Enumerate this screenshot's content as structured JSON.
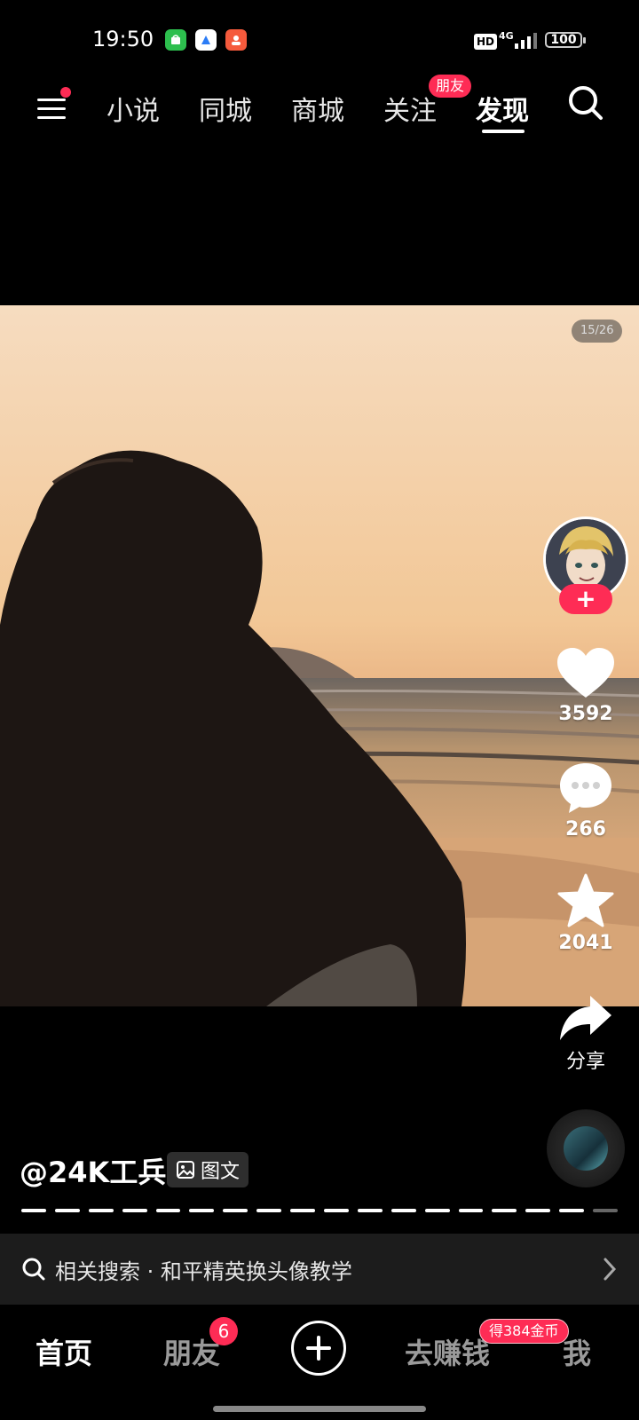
{
  "status_bar": {
    "time": "19:50",
    "hd": "HD",
    "network": "4G",
    "battery": "100",
    "app_icons": [
      "green-shopping-app-icon",
      "blue-app-icon",
      "red-app-icon"
    ]
  },
  "top_nav": {
    "tabs": [
      {
        "label": "小说"
      },
      {
        "label": "同城"
      },
      {
        "label": "商城"
      },
      {
        "label": "关注"
      },
      {
        "label": "发现"
      }
    ],
    "active_tab": "发现",
    "friends_badge": "朋友"
  },
  "post": {
    "page_counter": "15/26",
    "author": "@24K工兵",
    "type_label": "图文",
    "likes": "3592",
    "comments": "266",
    "favorites": "2041",
    "share_label": "分享",
    "total_images": 26,
    "current_image": 15
  },
  "related_search": {
    "text": "相关搜索 · 和平精英换头像教学"
  },
  "bottom_nav": {
    "home": "首页",
    "friends": "朋友",
    "friends_count": "6",
    "earn": "去赚钱",
    "coin_badge": "得384金币",
    "me": "我"
  },
  "colors": {
    "accent": "#fe2c55",
    "background": "#000000",
    "related_bar": "#1c1c1c"
  }
}
